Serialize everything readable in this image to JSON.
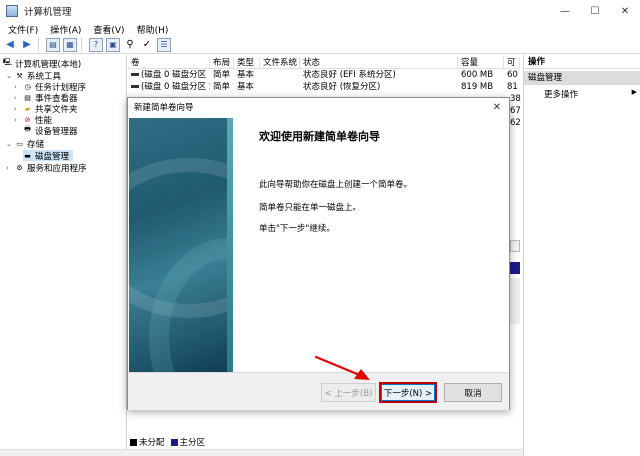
{
  "window": {
    "title": "计算机管理",
    "controls": {
      "minimize": "—",
      "maximize": "☐",
      "close": "✕"
    }
  },
  "menu": [
    "文件(F)",
    "操作(A)",
    "查看(V)",
    "帮助(H)"
  ],
  "tree": {
    "root": "计算机管理(本地)",
    "system_tools": "系统工具",
    "task_scheduler": "任务计划程序",
    "event_viewer": "事件查看器",
    "shared_folders": "共享文件夹",
    "performance": "性能",
    "device_manager": "设备管理器",
    "storage": "存储",
    "disk_management": "磁盘管理",
    "services_apps": "服务和应用程序"
  },
  "volume_list": {
    "headers": [
      "卷",
      "布局",
      "类型",
      "文件系统",
      "状态",
      "容量",
      "可"
    ],
    "rows": [
      {
        "volume": "(磁盘 0 磁盘分区 1)",
        "layout": "简单",
        "type": "基本",
        "fs": "",
        "status": "状态良好 (EFI 系统分区)",
        "capacity": "600 MB",
        "free": "60"
      },
      {
        "volume": "(磁盘 0 磁盘分区 5)",
        "layout": "简单",
        "type": "基本",
        "fs": "",
        "status": "状态良好 (恢复分区)",
        "capacity": "819 MB",
        "free": "81"
      }
    ],
    "partial_free": [
      "38",
      "67",
      "62"
    ]
  },
  "actions": {
    "header": "操作",
    "section": "磁盘管理",
    "more": "更多操作",
    "more_arrow": "▶"
  },
  "legend": [
    {
      "label": "未分配",
      "color": "#000000"
    },
    {
      "label": "主分区",
      "color": "#1a1a8a"
    }
  ],
  "dialog": {
    "title": "新建简单卷向导",
    "close": "✕",
    "heading": "欢迎使用新建简单卷向导",
    "line1": "此向导帮助你在磁盘上创建一个简单卷。",
    "line2": "简单卷只能在单一磁盘上。",
    "line3": "单击\"下一步\"继续。",
    "back_button": "< 上一步(B)",
    "next_button": "下一步(N) >",
    "cancel_button": "取消"
  }
}
